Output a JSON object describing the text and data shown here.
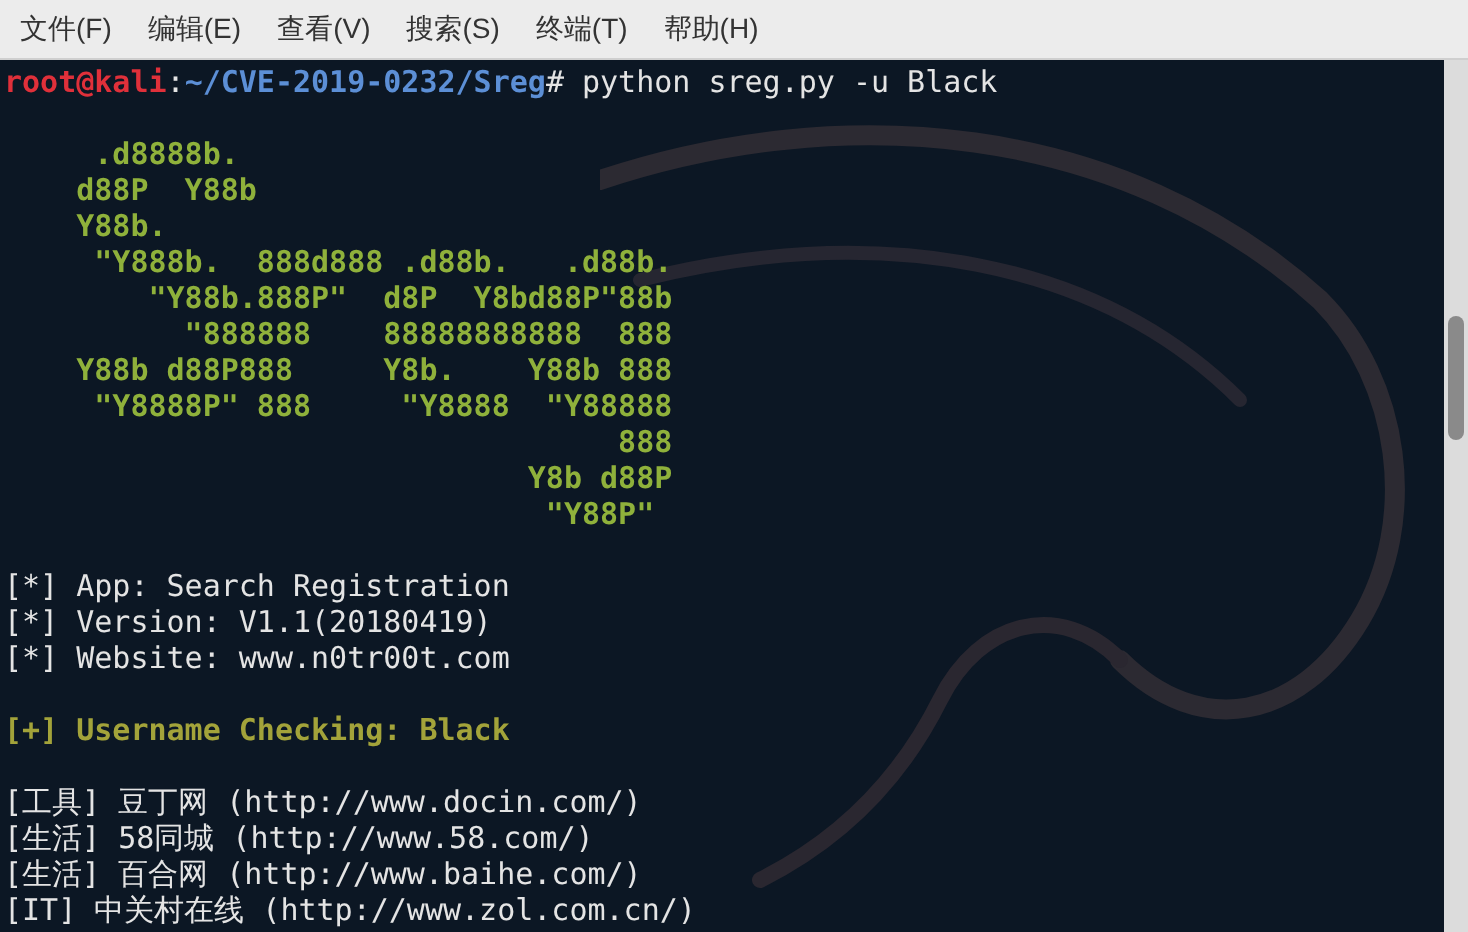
{
  "menu": [
    {
      "label": "文件(F)"
    },
    {
      "label": "编辑(E)"
    },
    {
      "label": "查看(V)"
    },
    {
      "label": "搜索(S)"
    },
    {
      "label": "终端(T)"
    },
    {
      "label": "帮助(H)"
    }
  ],
  "terminal": {
    "prompt": [
      {
        "kind": "user",
        "text": "root@kali"
      },
      {
        "kind": "plain",
        "text": ":"
      },
      {
        "kind": "path",
        "text": "~/CVE-2019-0232/Sreg"
      },
      {
        "kind": "plain",
        "text": "# python sreg.py -u Black"
      }
    ],
    "banner": [
      "     .d8888b.",
      "    d88P  Y88b",
      "    Y88b.",
      "     \"Y888b.  888d888 .d88b.   .d88b.",
      "        \"Y88b.888P\"  d8P  Y8bd88P\"88b",
      "          \"888888    88888888888  888",
      "    Y88b d88P888     Y8b.    Y88b 888",
      "     \"Y8888P\" 888     \"Y8888  \"Y88888",
      "                                  888",
      "                             Y8b d88P",
      "                              \"Y88P\""
    ],
    "info": [
      "[*] App: Search Registration",
      "[*] Version: V1.1(20180419)",
      "[*] Website: www.n0tr00t.com"
    ],
    "status": "[+] Username Checking: Black",
    "results": [
      "[工具] 豆丁网 (http://www.docin.com/)",
      "[生活] 58同城 (http://www.58.com/)",
      "[生活] 百合网 (http://www.baihe.com/)",
      "[IT] 中关村在线 (http://www.zol.com.cn/)"
    ]
  }
}
